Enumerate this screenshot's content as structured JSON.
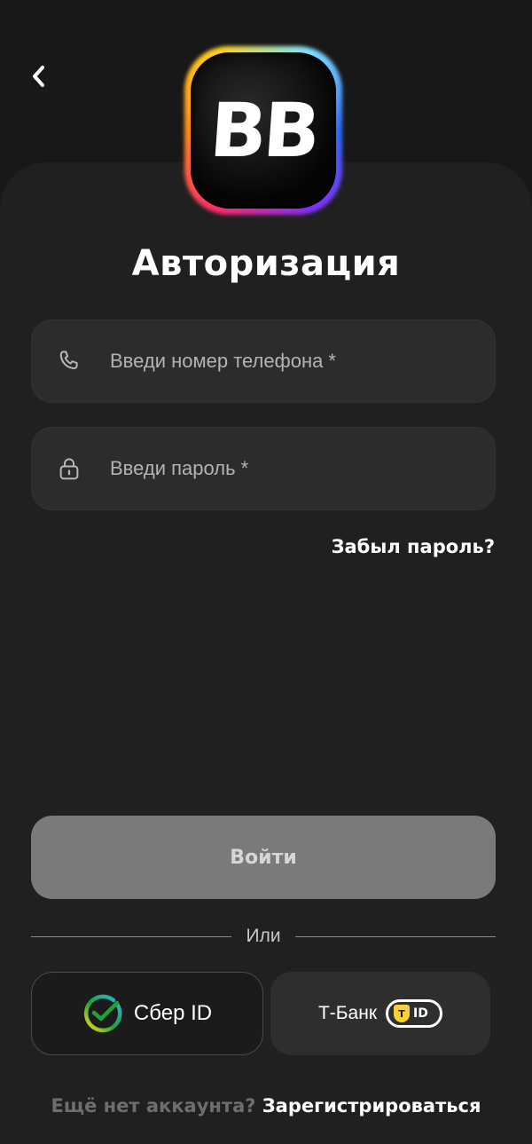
{
  "header": {
    "back_icon": "chevron-left-icon",
    "logo_text": "BB"
  },
  "title": "Авторизация",
  "phone_field": {
    "icon": "phone-icon",
    "placeholder": "Введи номер телефона *"
  },
  "password_field": {
    "icon": "lock-icon",
    "placeholder": "Введи пароль *"
  },
  "forgot_password": "Забыл пароль?",
  "login_button": "Войти",
  "divider_text": "Или",
  "sber_button": {
    "icon": "sber-check-icon",
    "label": "Сбер ID"
  },
  "tbank_button": {
    "label": "Т-Банк",
    "badge_letter": "Т",
    "badge_text": "ID"
  },
  "register": {
    "question": "Ещё нет аккаунта?",
    "link": "Зарегистрироваться"
  },
  "colors": {
    "background": "#181818",
    "sheet": "#202020",
    "field": "#2c2c2c",
    "login_button_disabled": "#7a7a7a",
    "sber_green": "#21a038",
    "tbank_yellow": "#f7d038"
  }
}
